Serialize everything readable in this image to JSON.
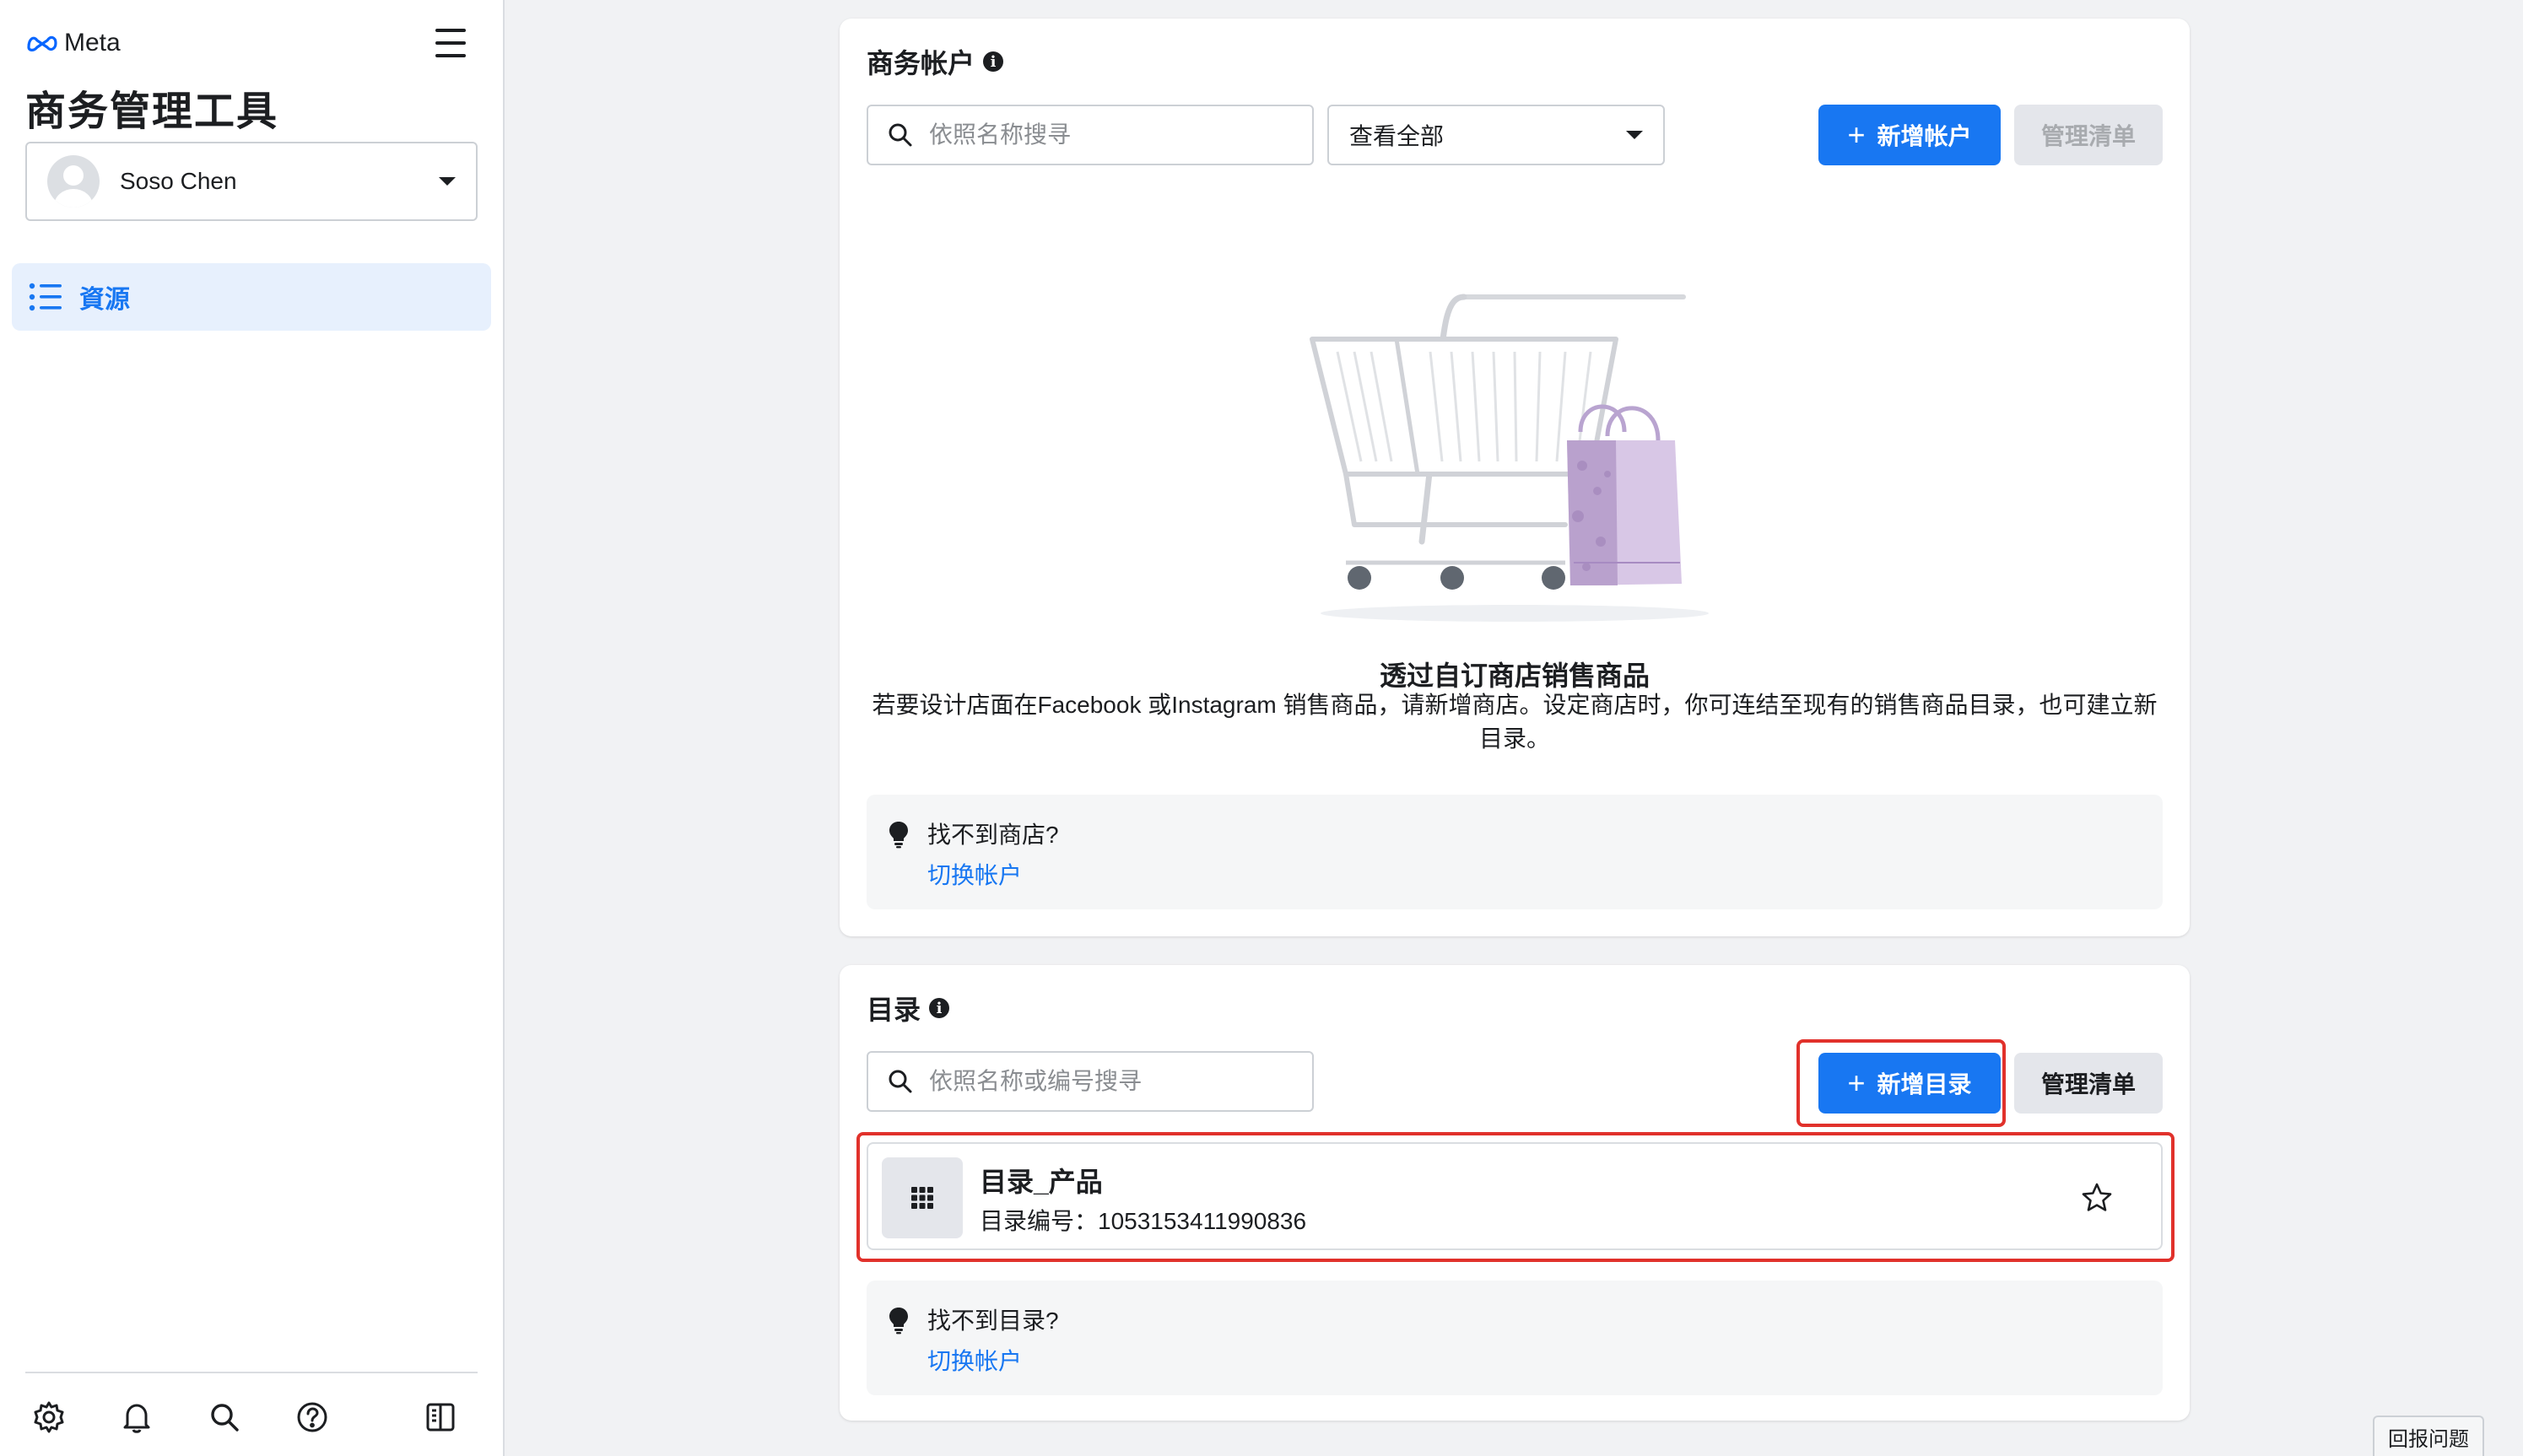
{
  "sidebar": {
    "brand": "Meta",
    "app_title": "商务管理工具",
    "account_name": "Soso Chen",
    "nav_items": [
      {
        "label": "資源",
        "icon": "list-icon",
        "active": true
      }
    ],
    "bottom_icons": [
      "gear-icon",
      "bell-icon",
      "search-icon",
      "help-icon",
      "panel-toggle-icon"
    ]
  },
  "commerce_accounts": {
    "title": "商务帐户",
    "search_placeholder": "依照名称搜寻",
    "filter_value": "查看全部",
    "add_button": "新增帐户",
    "manage_button": "管理清单",
    "empty_title": "透过自订商店销售商品",
    "empty_description": "若要设计店面在Facebook 或Instagram 销售商品，请新增商店。设定商店时，你可连结至现有的销售商品目录，也可建立新目录。",
    "tip_title": "找不到商店?",
    "tip_link": "切换帐户"
  },
  "catalogs": {
    "title": "目录",
    "search_placeholder": "依照名称或编号搜寻",
    "add_button": "新增目录",
    "manage_button": "管理清单",
    "items": [
      {
        "name": "目录_产品",
        "id_text": "目录编号：1053153411990836"
      }
    ],
    "tip_title": "找不到目录?",
    "tip_link": "切换帐户"
  },
  "report_button": "回报问题",
  "colors": {
    "primary": "#1877f2",
    "highlight": "#e1312b",
    "active_nav_bg": "#e7f0fd",
    "page_bg": "#f1f2f4"
  }
}
